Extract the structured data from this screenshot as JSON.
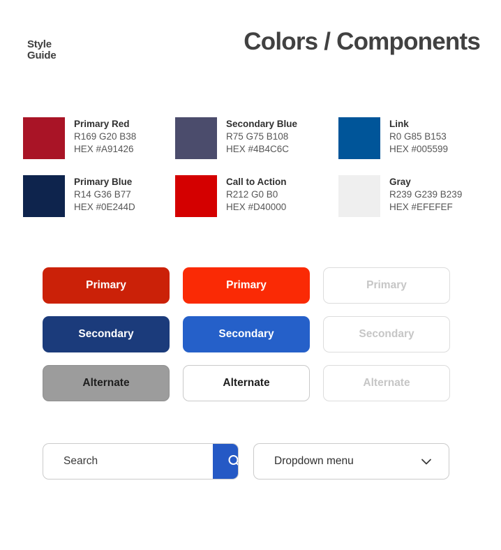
{
  "header": {
    "style_guide_line1": "Style",
    "style_guide_line2": "Guide",
    "title": "Colors / Components"
  },
  "swatches": [
    {
      "name": "Primary Red",
      "rgb": "R169 G20 B38",
      "hex_label": "HEX #A91426",
      "hex": "#A91426"
    },
    {
      "name": "Secondary Blue",
      "rgb": "R75 G75 B108",
      "hex_label": "HEX #4B4C6C",
      "hex": "#4B4C6C"
    },
    {
      "name": "Link",
      "rgb": "R0 G85 B153",
      "hex_label": "HEX #005599",
      "hex": "#005599"
    },
    {
      "name": "Primary Blue",
      "rgb": "R14 G36 B77",
      "hex_label": "HEX #0E244D",
      "hex": "#0E244D"
    },
    {
      "name": "Call to Action",
      "rgb": "R212 G0 B0",
      "hex_label": "HEX #D40000",
      "hex": "#D40000"
    },
    {
      "name": "Gray",
      "rgb": "R239 G239 B239",
      "hex_label": "HEX #EFEFEF",
      "hex": "#EFEFEF"
    }
  ],
  "buttons": [
    {
      "label": "Primary",
      "state": "default",
      "bg": "#CB2108"
    },
    {
      "label": "Primary",
      "state": "hover",
      "bg": "#FA2A05"
    },
    {
      "label": "Primary",
      "state": "disabled",
      "bg": "#FFFFFF"
    },
    {
      "label": "Secondary",
      "state": "default",
      "bg": "#1B3B7B"
    },
    {
      "label": "Secondary",
      "state": "hover",
      "bg": "#2560C9"
    },
    {
      "label": "Secondary",
      "state": "disabled",
      "bg": "#FFFFFF"
    },
    {
      "label": "Alternate",
      "state": "default",
      "bg": "#9C9C9C"
    },
    {
      "label": "Alternate",
      "state": "outline",
      "bg": "#FFFFFF"
    },
    {
      "label": "Alternate",
      "state": "disabled",
      "bg": "#FFFFFF"
    }
  ],
  "search": {
    "placeholder": "Search",
    "value": "",
    "button_icon": "search-icon",
    "button_bg": "#2559C5"
  },
  "dropdown": {
    "label": "Dropdown menu",
    "icon": "chevron-down-icon"
  }
}
